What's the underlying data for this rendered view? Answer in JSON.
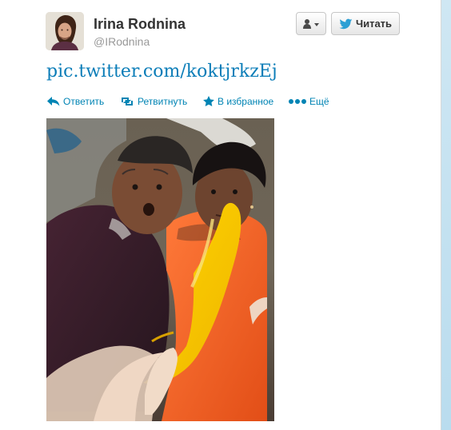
{
  "user": {
    "name": "Irina Rodnina",
    "handle": "@IRodnina",
    "avatar_icon": "profile-photo"
  },
  "buttons": {
    "user_menu_icon": "user-icon",
    "user_menu_caret_icon": "caret-down-icon",
    "follow_icon": "bird-icon",
    "follow_label": "Читать"
  },
  "tweet": {
    "link_text": "pic.twitter.com/koktjrkzEj"
  },
  "actions": [
    {
      "label": "Ответить",
      "icon": "reply-icon"
    },
    {
      "label": "Ретвитнуть",
      "icon": "retweet-icon"
    },
    {
      "label": "В избранное",
      "icon": "star-icon"
    },
    {
      "label": "Ещё",
      "icon": "more-icon"
    }
  ],
  "media": {
    "description_icon": "attached-photo"
  },
  "colors": {
    "link": "#0b7db8",
    "action": "#0084b4",
    "page_background": "#c0deed",
    "card_background": "#ffffff"
  }
}
